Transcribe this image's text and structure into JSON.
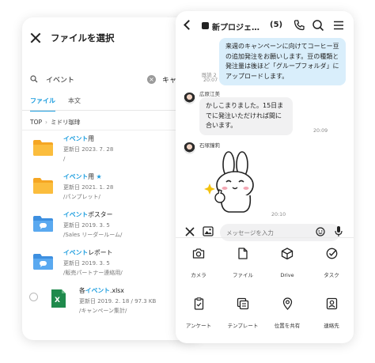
{
  "file_picker": {
    "title": "ファイルを選択",
    "search_value": "イベント",
    "cancel_label": "キャン",
    "tabs": [
      {
        "label": "ファイル",
        "active": true
      },
      {
        "label": "本文",
        "active": false
      }
    ],
    "breadcrumb": [
      "TOP",
      "ミドリ珈琲"
    ],
    "items": [
      {
        "icon": "folder-icon",
        "name_hl": "イベント",
        "name_rest": "用",
        "starred": false,
        "date": "更新日 2023. 7. 28",
        "path": "/"
      },
      {
        "icon": "folder-icon",
        "name_hl": "イベント",
        "name_rest": "用",
        "starred": true,
        "date": "更新日 2021. 1. 28",
        "path": "/パンプレット/"
      },
      {
        "icon": "shared-folder-icon",
        "name_hl": "イベント",
        "name_rest": "ポスター",
        "starred": false,
        "date": "更新日 2019. 3. 5",
        "path": "/Sales リーダールーム/"
      },
      {
        "icon": "shared-folder-icon",
        "name_hl": "イベント",
        "name_rest": "レポート",
        "starred": false,
        "date": "更新日 2019. 3. 5",
        "path": "/販売パートナー連絡用/"
      },
      {
        "icon": "excel-file-icon",
        "name_pre": "各",
        "name_hl": "イベント",
        "name_rest": ".xlsx",
        "starred": false,
        "date": "更新日 2019. 2. 18 / 97.3 KB",
        "path": "/キャンペーン集計/"
      }
    ]
  },
  "chat": {
    "title": "新プロジェ…",
    "member_count": "(5)",
    "messages": [
      {
        "from": "me",
        "text": "来週のキャンペーンに向けてコーヒー豆の追加発注をお願いします。豆の種類と発注量は後ほど「グループフォルダ」にアップロードします。",
        "read": "既読 2",
        "time": "20:07"
      },
      {
        "from": "other",
        "sender": "広原江美",
        "text": "かしこまりました。15日までに発注いただければ間に合います。",
        "time": "20:09"
      },
      {
        "from": "other",
        "sender": "石塚鐘莉",
        "sticker": "sticker-icon",
        "time": "20:10"
      }
    ],
    "input_placeholder": "メッセージを入力",
    "attachments": [
      {
        "label": "カメラ",
        "icon": "camera-icon"
      },
      {
        "label": "ファイル",
        "icon": "file-icon"
      },
      {
        "label": "Drive",
        "icon": "drive-icon"
      },
      {
        "label": "タスク",
        "icon": "task-icon"
      },
      {
        "label": "アンケート",
        "icon": "survey-icon"
      },
      {
        "label": "テンプレート",
        "icon": "template-icon"
      },
      {
        "label": "位置を共有",
        "icon": "location-icon"
      },
      {
        "label": "連絡先",
        "icon": "contact-icon"
      }
    ]
  }
}
